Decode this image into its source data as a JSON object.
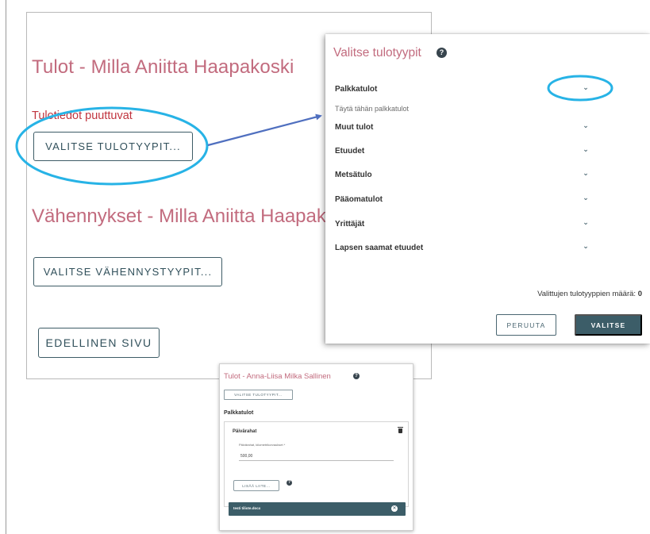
{
  "page": {
    "income_heading": "Tulot - Milla Aniitta Haapakoski",
    "missing_notice": "Tulotiedot puuttuvat",
    "select_income_button": "VALITSE TULOTYYPIT...",
    "deductions_heading": "Vähennykset - Milla Aniitta Haapakoski",
    "select_deductions_button": "VALITSE VÄHENNYSTYYPIT...",
    "previous_button": "EDELLINEN SIVU"
  },
  "dialog": {
    "title": "Valitse tulotyypit",
    "help": "?",
    "categories": [
      {
        "label": "Palkkatulot"
      },
      {
        "label": "Muut tulot"
      },
      {
        "label": "Etuudet"
      },
      {
        "label": "Metsätulo"
      },
      {
        "label": "Pääomatulot"
      },
      {
        "label": "Yrittäjät"
      },
      {
        "label": "Lapsen saamat etuudet"
      }
    ],
    "category_hint": "Täytä tähän palkkatulot",
    "chevron": "⌄",
    "selected_count_label": "Valittujen tulotyyppien määrä:",
    "selected_count_value": "0",
    "cancel_button": "PERUUTA",
    "select_button": "VALITSE"
  },
  "sub_screenshot": {
    "title": "Tulot - Anna-Liisa Milka Sallinen",
    "help": "?",
    "select_income_button": "VALITSE TULOTYYPIT...",
    "section_label": "Palkkatulot",
    "panel_title": "Päivärahat",
    "field_label": "Päivärahat, kilometrikorvaukset *",
    "field_value": "500,00",
    "add_attachment_button": "LISÄÄ LIITE...",
    "file_name": "testi tiliote.docx",
    "file_close": "✕"
  },
  "colors": {
    "heading": "#c26b7e",
    "error": "#c0343e",
    "primary": "#3c5d68",
    "annotation": "#27b3e6",
    "arrow": "#4f6fbf"
  }
}
